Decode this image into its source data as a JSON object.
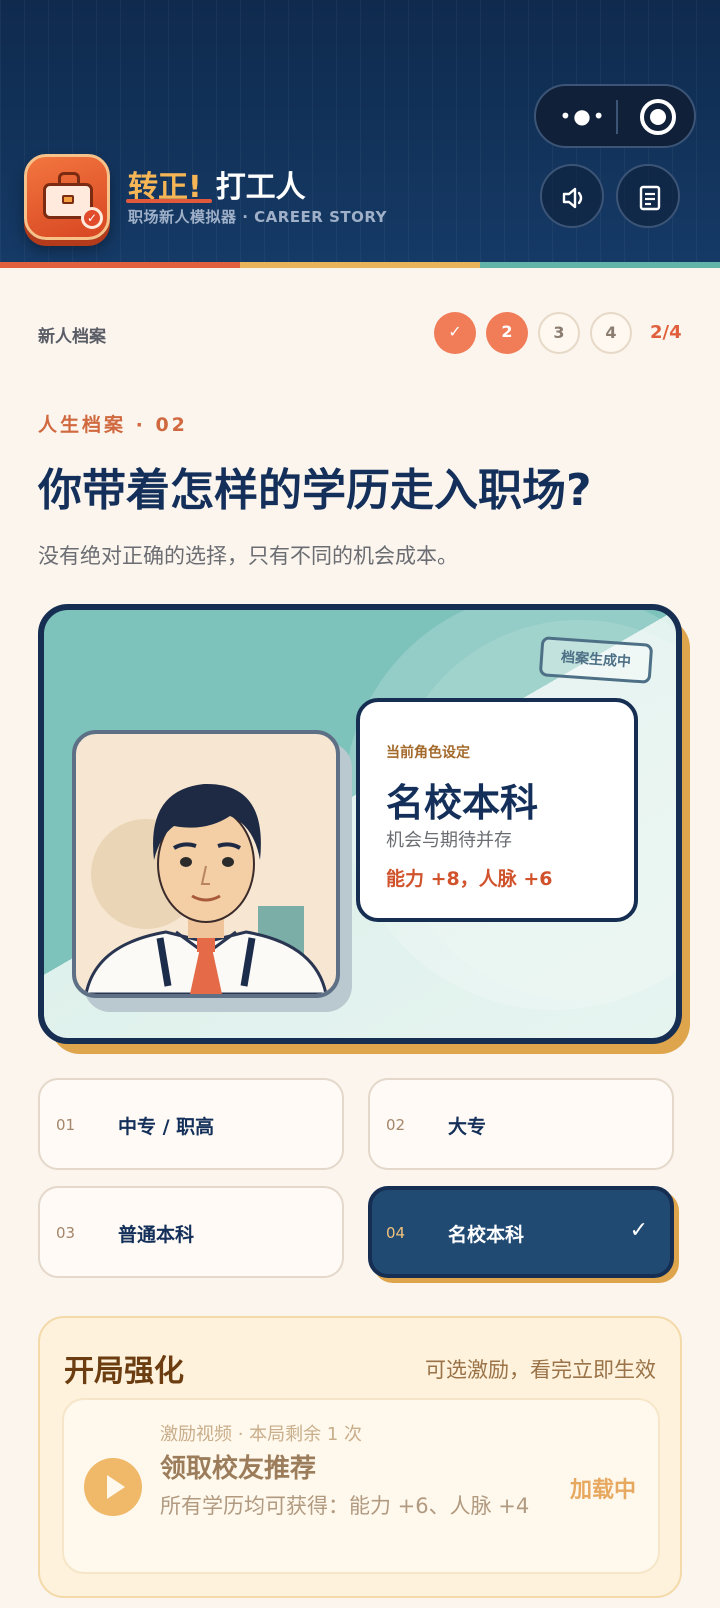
{
  "app": {
    "title_accent": "转正!",
    "title_main": "打工人",
    "subtitle": "职场新人模拟器 · CAREER STORY",
    "capsule_menu_icon": "more-dots-icon",
    "capsule_close_icon": "target-icon"
  },
  "header_buttons": {
    "sound_icon": "speaker-icon",
    "records_icon": "notebook-icon"
  },
  "progress": {
    "label": "新人档案",
    "steps": [
      "✓",
      "2",
      "3",
      "4"
    ],
    "current_step": 2,
    "total_steps": 4,
    "count_text": "2/4"
  },
  "question": {
    "kicker": "人生档案 · 02",
    "title": "你带着怎样的学历走入职场?",
    "hint": "没有绝对正确的选择，只有不同的机会成本。"
  },
  "hero": {
    "stamp": "档案生成中",
    "card_label": "当前角色设定",
    "card_title": "名校本科",
    "card_desc": "机会与期待并存",
    "card_bonus": "能力 +8，人脉 +6"
  },
  "options": [
    {
      "num": "01",
      "label": "中专 / 职高",
      "selected": false
    },
    {
      "num": "02",
      "label": "大专",
      "selected": false
    },
    {
      "num": "03",
      "label": "普通本科",
      "selected": false
    },
    {
      "num": "04",
      "label": "名校本科",
      "selected": true
    }
  ],
  "boost": {
    "title": "开局强化",
    "subtitle": "可选激励，看完立即生效",
    "meta": "激励视频 · 本局剩余 1 次",
    "reward": "领取校友推荐",
    "detail": "所有学历均可获得：能力 +6、人脉 +4",
    "status": "加载中"
  },
  "colors": {
    "header_bg": "#0f2a4d",
    "accent_orange": "#f07c58",
    "accent_gold": "#dfa54c",
    "navy": "#14305a",
    "teal": "#7dc3bb"
  }
}
